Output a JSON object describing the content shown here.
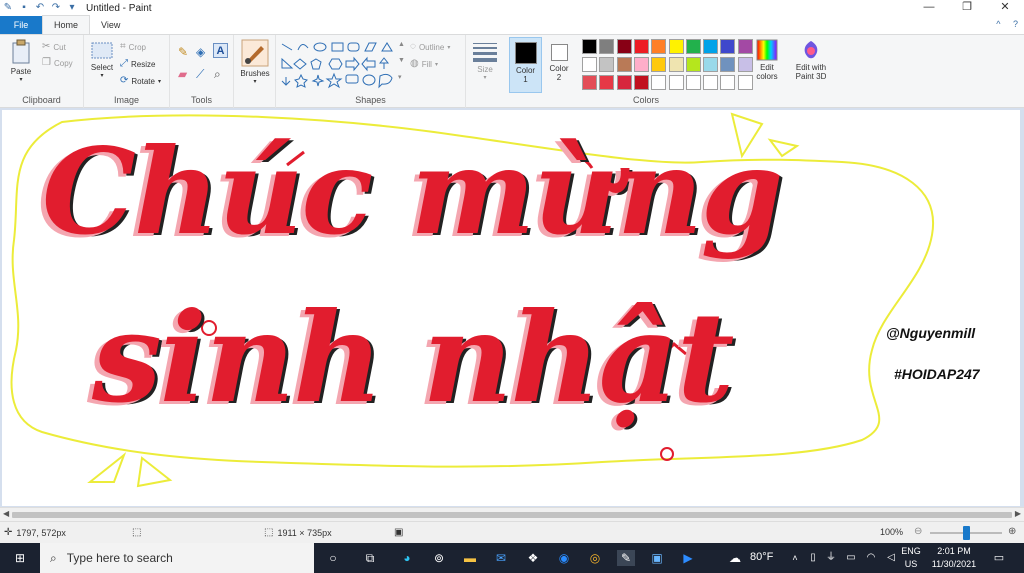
{
  "window": {
    "title": "Untitled - Paint",
    "minimize": "—",
    "restore": "❐",
    "close": "✕"
  },
  "tabs": [
    {
      "label": "File"
    },
    {
      "label": "Home"
    },
    {
      "label": "View"
    }
  ],
  "help": {
    "expand": "^",
    "help": "?"
  },
  "ribbon": {
    "clipboard": {
      "label": "Clipboard",
      "paste": "Paste",
      "cut": "Cut",
      "copy": "Copy"
    },
    "image": {
      "label": "Image",
      "select": "Select",
      "crop": "Crop",
      "resize": "Resize",
      "rotate": "Rotate"
    },
    "tools": {
      "label": "Tools"
    },
    "brushes": {
      "label": "Brushes"
    },
    "shapes": {
      "label": "Shapes",
      "outline": "Outline",
      "fill": "Fill"
    },
    "size": {
      "label": "Size"
    },
    "colors": {
      "label": "Colors",
      "color1": "Color 1",
      "color1_line1": "Color",
      "color1_line2": "1",
      "color2_line1": "Color",
      "color2_line2": "2",
      "edit_colors_line1": "Edit",
      "edit_colors_line2": "colors",
      "paint3d_line1": "Edit with",
      "paint3d_line2": "Paint 3D",
      "palette_row1": [
        "#000000",
        "#7f7f7f",
        "#880015",
        "#ed1c24",
        "#ff7f27",
        "#fff200",
        "#22b14c",
        "#00a2e8",
        "#3f48cc",
        "#a349a4"
      ],
      "palette_row2": [
        "#ffffff",
        "#c3c3c3",
        "#b97a57",
        "#ffaec9",
        "#ffc90e",
        "#efe4b0",
        "#b5e61d",
        "#99d9ea",
        "#7092be",
        "#c8bfe7"
      ],
      "palette_row3": [
        "#e34d57",
        "#e63946",
        "#d7263d",
        "#c1121f",
        "#ffffff",
        "#ffffff",
        "#ffffff",
        "#ffffff",
        "#ffffff",
        "#ffffff"
      ]
    }
  },
  "canvas": {
    "line1": "Chúc mừng",
    "line2": "sinh nhật",
    "handle1": "@Nguyenmill",
    "handle2": "#HOIDAP247",
    "colors": {
      "red": "#e11d2e",
      "pink": "#f4a6b0",
      "yellow": "#ecec3a",
      "outline": "#222222"
    }
  },
  "status": {
    "cursor": "1797, 572px",
    "canvas_size": "1911 × 735px",
    "zoom": "100%",
    "zoom_level": 0.5
  },
  "taskbar": {
    "search_placeholder": "Type here to search",
    "weather": "80°F",
    "lang_line1": "ENG",
    "lang_line2": "US",
    "time": "2:01 PM",
    "date": "11/30/2021"
  }
}
